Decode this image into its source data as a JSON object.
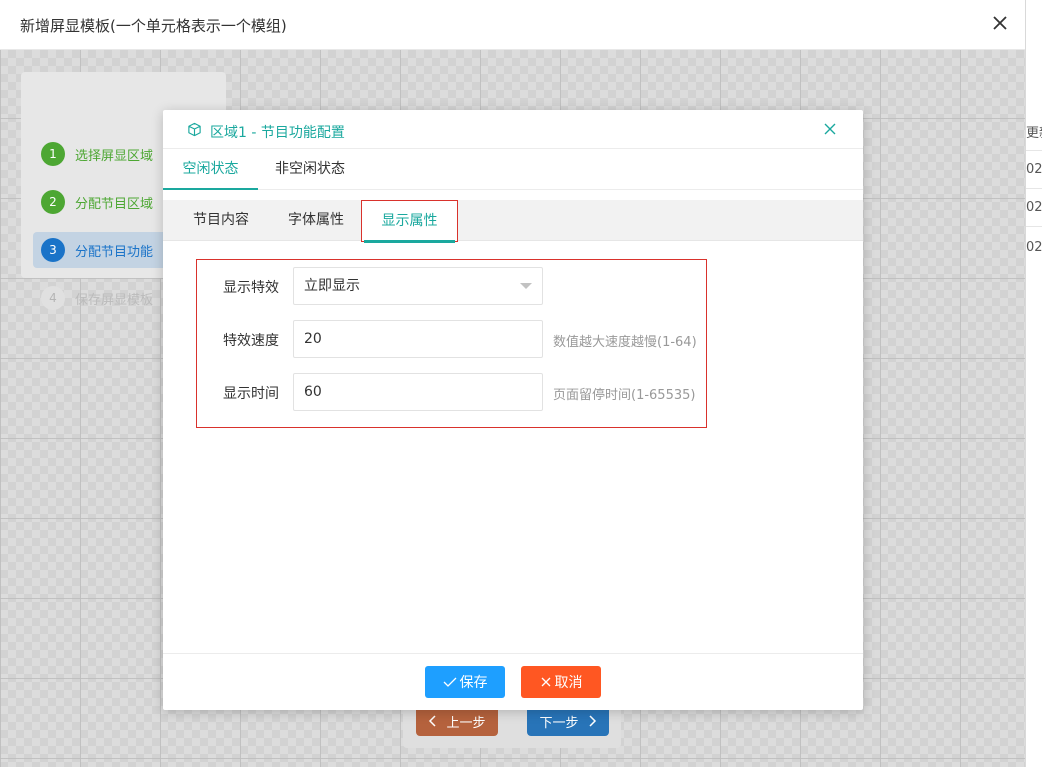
{
  "outer_dialog": {
    "title": "新增屏显模板(一个单元格表示一个模组)"
  },
  "steps": [
    {
      "num": "1",
      "label": "选择屏显区域",
      "state": "done"
    },
    {
      "num": "2",
      "label": "分配节目区域",
      "state": "done"
    },
    {
      "num": "3",
      "label": "分配节目功能",
      "state": "active"
    },
    {
      "num": "4",
      "label": "保存屏显模板",
      "state": "pending"
    }
  ],
  "nav": {
    "prev_label": "上一步",
    "next_label": "下一步"
  },
  "background_fragments": [
    "更新",
    "02",
    "02",
    "02"
  ],
  "modal": {
    "title": "区域1 - 节目功能配置",
    "tabs": [
      "空闲状态",
      "非空闲状态"
    ],
    "subtabs": [
      "节目内容",
      "字体属性",
      "显示属性"
    ],
    "form": {
      "effect_label": "显示特效",
      "effect_value": "立即显示",
      "speed_label": "特效速度",
      "speed_value": "20",
      "speed_hint": "数值越大速度越慢(1-64)",
      "time_label": "显示时间",
      "time_value": "60",
      "time_hint": "页面留停时间(1-65535)"
    },
    "save_label": "保存",
    "cancel_label": "取消"
  },
  "colors": {
    "accent": "#1aa89e",
    "save": "#1e9fff",
    "cancel": "#ff5722",
    "highlight_border": "#d9322c"
  }
}
